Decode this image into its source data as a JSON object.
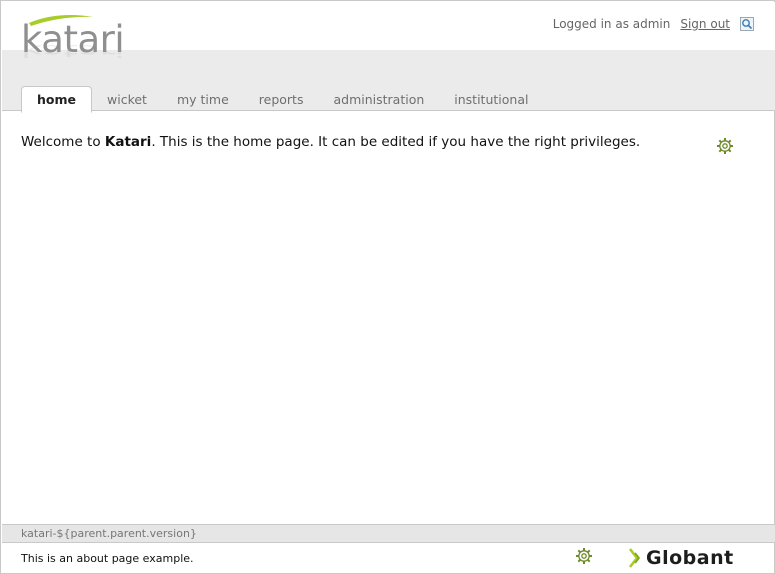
{
  "logo": {
    "text": "katari"
  },
  "userbar": {
    "logged_in": "Logged in as admin",
    "sign_out": "Sign out"
  },
  "tabs": [
    {
      "label": "home",
      "active": true
    },
    {
      "label": "wicket"
    },
    {
      "label": "my time"
    },
    {
      "label": "reports"
    },
    {
      "label": "administration"
    },
    {
      "label": "institutional"
    }
  ],
  "main": {
    "welcome_prefix": "Welcome to ",
    "welcome_brand": "Katari",
    "welcome_suffix": ". This is the home page. It can be edited if you have the right privileges."
  },
  "footer": {
    "version": "katari-${parent.parent.version}",
    "about": "This is an about page example.",
    "brand": "Globant"
  },
  "colors": {
    "accent_green": "#a8cc2a",
    "header_gray": "#ebebeb",
    "gear_green": "#6f8a2a"
  },
  "icons": {
    "search": "search-icon",
    "gear": "gear-icon",
    "globant_logo": "globant-logo-icon"
  }
}
